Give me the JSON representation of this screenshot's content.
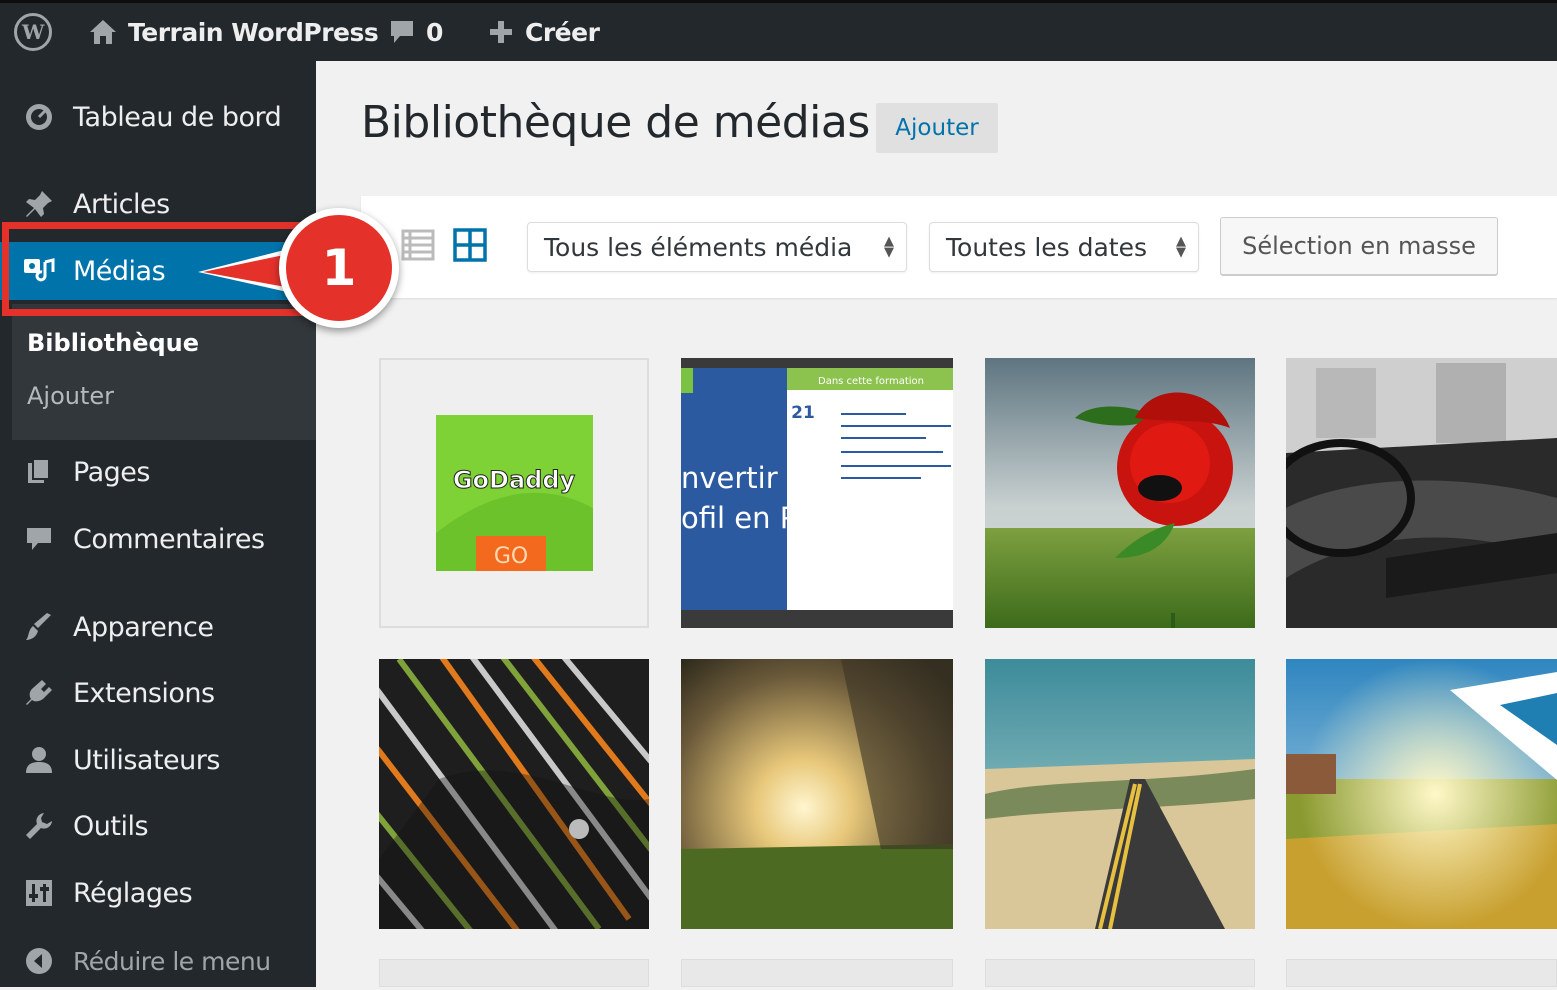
{
  "adminbar": {
    "site_title": "Terrain WordPress",
    "comment_count": "0",
    "new_label": "Créer"
  },
  "sidebar": {
    "items": [
      {
        "label": "Tableau de bord",
        "icon": "dashboard-icon"
      },
      {
        "label": "Articles",
        "icon": "pin-icon"
      },
      {
        "label": "Médias",
        "icon": "media-icon",
        "active": true
      },
      {
        "label": "Pages",
        "icon": "page-icon"
      },
      {
        "label": "Commentaires",
        "icon": "comment-icon"
      },
      {
        "label": "Apparence",
        "icon": "brush-icon"
      },
      {
        "label": "Extensions",
        "icon": "plugin-icon"
      },
      {
        "label": "Utilisateurs",
        "icon": "user-icon"
      },
      {
        "label": "Outils",
        "icon": "wrench-icon"
      },
      {
        "label": "Réglages",
        "icon": "settings-icon"
      }
    ],
    "submenu": [
      {
        "label": "Bibliothèque",
        "current": true
      },
      {
        "label": "Ajouter"
      }
    ],
    "collapse_label": "Réduire le menu"
  },
  "main": {
    "title": "Bibliothèque de médias",
    "add_button": "Ajouter",
    "toolbar": {
      "type_filter": "Tous les éléments média",
      "date_filter": "Toutes les dates",
      "bulk_select": "Sélection en masse"
    },
    "thumbnails": [
      {
        "kind": "logo",
        "text": "GoDaddy",
        "subtext": "GO"
      },
      {
        "kind": "slide",
        "lines": [
          "nvertir son",
          "ofil en Page"
        ],
        "number": "21",
        "header": "Dans cette formation"
      },
      {
        "kind": "rose"
      },
      {
        "kind": "car-interior"
      },
      {
        "kind": "stripes"
      },
      {
        "kind": "sunlight"
      },
      {
        "kind": "road"
      },
      {
        "kind": "meadow"
      }
    ]
  },
  "annotation": {
    "step": "1"
  },
  "colors": {
    "admin_bg": "#23282d",
    "active": "#0073aa",
    "highlight": "#e4322b"
  }
}
